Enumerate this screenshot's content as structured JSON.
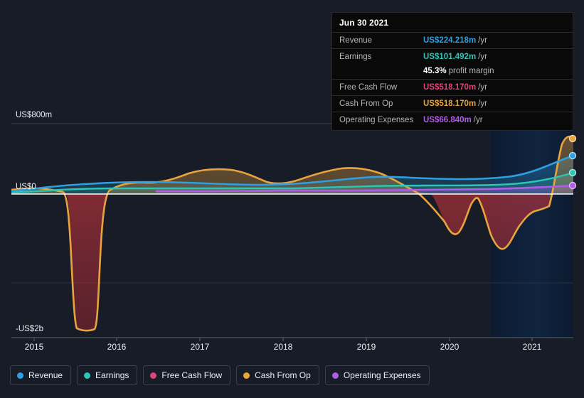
{
  "tooltip": {
    "date": "Jun 30 2021",
    "rows": [
      {
        "label": "Revenue",
        "value": "US$224.218m",
        "unit": "/yr",
        "color": "#2e9fe0"
      },
      {
        "label": "Earnings",
        "value": "US$101.492m",
        "unit": "/yr",
        "color": "#2ec4b6"
      },
      {
        "label": "",
        "value": "45.3%",
        "unit": "profit margin",
        "color": "#ffffff"
      },
      {
        "label": "Free Cash Flow",
        "value": "US$518.170m",
        "unit": "/yr",
        "color": "#e0437a"
      },
      {
        "label": "Cash From Op",
        "value": "US$518.170m",
        "unit": "/yr",
        "color": "#e8a33d"
      },
      {
        "label": "Operating Expenses",
        "value": "US$66.840m",
        "unit": "/yr",
        "color": "#b05ce8"
      }
    ]
  },
  "legend": {
    "items": [
      {
        "label": "Revenue",
        "color": "#2e9fe0"
      },
      {
        "label": "Earnings",
        "color": "#2ec4b6"
      },
      {
        "label": "Free Cash Flow",
        "color": "#e0437a"
      },
      {
        "label": "Cash From Op",
        "color": "#e8a33d"
      },
      {
        "label": "Operating Expenses",
        "color": "#b05ce8"
      }
    ]
  },
  "chart_data": {
    "type": "area",
    "title": "",
    "xlabel": "",
    "ylabel": "",
    "grid": true,
    "legend_position": "bottom",
    "ylim": [
      -2000,
      800
    ],
    "yticks": [
      800,
      0,
      -1000,
      -2000
    ],
    "ytick_labels": [
      "US$800m",
      "US$0",
      "",
      "-US$2b"
    ],
    "y_axis_unit": "USD millions",
    "xlim": [
      2014.6,
      2021.6
    ],
    "xticks": [
      2015,
      2016,
      2017,
      2018,
      2019,
      2020,
      2021
    ],
    "xtick_labels": [
      "2015",
      "2016",
      "2017",
      "2018",
      "2019",
      "2020",
      "2021"
    ],
    "forecast_start": 2020.55,
    "zero_line": 0,
    "series": [
      {
        "name": "Revenue",
        "color": "#2e9fe0",
        "x": [
          2014.6,
          2015.0,
          2015.4,
          2015.8,
          2016.0,
          2016.4,
          2016.8,
          2017.2,
          2017.6,
          2018.0,
          2018.4,
          2018.8,
          2019.2,
          2019.6,
          2020.0,
          2020.4,
          2020.8,
          2021.1,
          2021.4,
          2021.6
        ],
        "values": [
          30,
          40,
          55,
          75,
          85,
          90,
          92,
          88,
          84,
          82,
          88,
          96,
          108,
          116,
          112,
          120,
          128,
          150,
          200,
          224
        ]
      },
      {
        "name": "Earnings",
        "color": "#2ec4b6",
        "x": [
          2014.6,
          2015.0,
          2015.4,
          2015.8,
          2016.0,
          2016.4,
          2016.8,
          2017.2,
          2017.6,
          2018.0,
          2018.4,
          2018.8,
          2019.2,
          2019.6,
          2020.0,
          2020.4,
          2020.8,
          2021.1,
          2021.4,
          2021.6
        ],
        "values": [
          8,
          12,
          18,
          26,
          30,
          34,
          36,
          34,
          32,
          30,
          33,
          38,
          44,
          50,
          46,
          48,
          52,
          62,
          88,
          101
        ]
      },
      {
        "name": "Free Cash Flow",
        "color": "#e0437a",
        "x": [
          2014.6,
          2021.6
        ],
        "values": [
          0,
          518
        ],
        "note": "hidden beneath Cash From Op (identical values)"
      },
      {
        "name": "Cash From Op",
        "color": "#e8a33d",
        "x": [
          2014.6,
          2014.95,
          2015.12,
          2015.25,
          2015.45,
          2015.75,
          2015.9,
          2016.05,
          2016.3,
          2016.7,
          2017.0,
          2017.3,
          2017.6,
          2017.9,
          2018.2,
          2018.6,
          2018.9,
          2019.15,
          2019.45,
          2019.7,
          2019.95,
          2020.2,
          2020.45,
          2020.7,
          2020.95,
          2021.2,
          2021.45,
          2021.6
        ],
        "values": [
          55,
          62,
          45,
          -1880,
          -1990,
          -1960,
          -700,
          75,
          60,
          120,
          160,
          175,
          155,
          130,
          150,
          190,
          200,
          150,
          20,
          -330,
          -430,
          -200,
          -620,
          -560,
          -110,
          -80,
          760,
          700
        ]
      },
      {
        "name": "Operating Expenses",
        "color": "#b05ce8",
        "x": [
          2016.45,
          2017.0,
          2018.0,
          2019.0,
          2020.0,
          2021.0,
          2021.6
        ],
        "values": [
          22,
          24,
          26,
          30,
          34,
          44,
          67
        ]
      }
    ],
    "end_markers": [
      {
        "series": "Cash From Op",
        "value": 700,
        "color": "#e8a33d"
      },
      {
        "series": "Revenue",
        "value": 224,
        "color": "#2e9fe0"
      },
      {
        "series": "Earnings",
        "value": 101,
        "color": "#2ec4b6"
      },
      {
        "series": "Operating Expenses",
        "value": 67,
        "color": "#b05ce8"
      }
    ]
  }
}
